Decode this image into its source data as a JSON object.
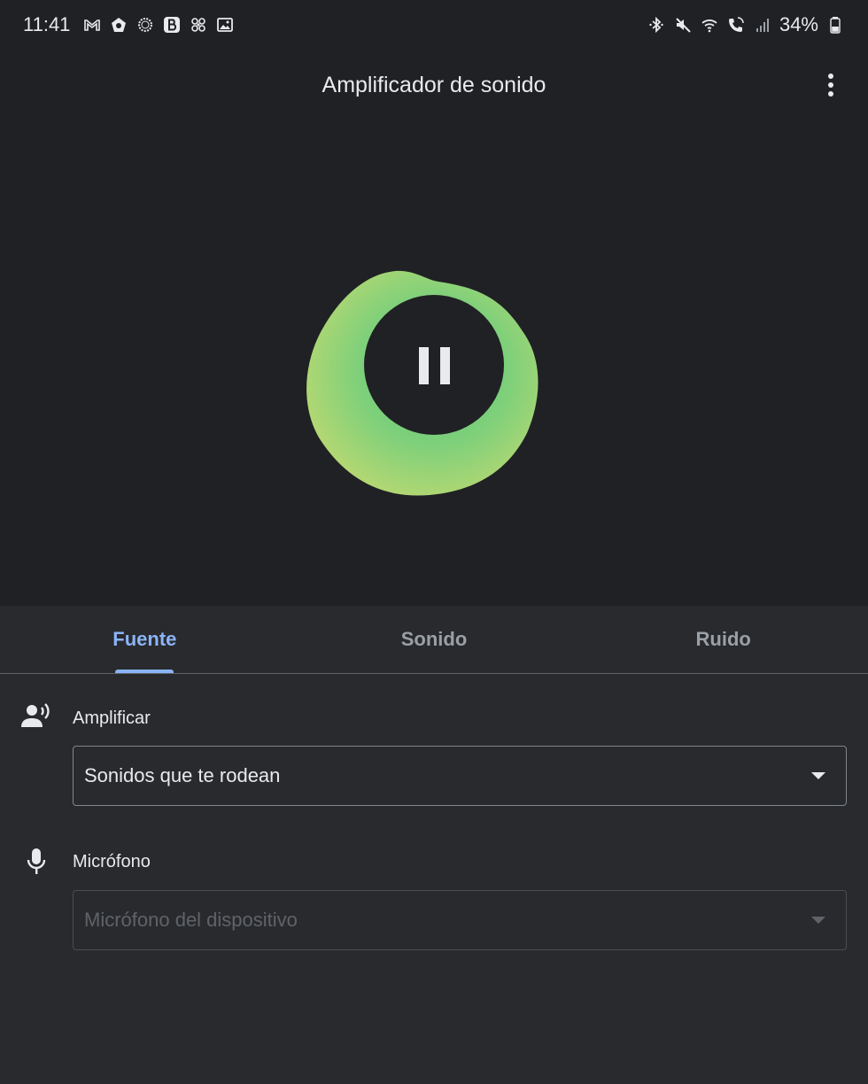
{
  "status_bar": {
    "time": "11:41",
    "battery": "34%",
    "left_icons": [
      "gmail-icon",
      "pentagon-app-icon",
      "sun-ring-icon",
      "b-app-icon",
      "fan-icon",
      "image-icon"
    ],
    "right_icons": [
      "bluetooth-icon",
      "mute-icon",
      "wifi-icon",
      "wifi-call-icon",
      "signal-icon",
      "battery-icon"
    ]
  },
  "app_bar": {
    "title": "Amplificador de sonido",
    "menu_icon": "more-vert-icon"
  },
  "hero": {
    "control_state": "playing",
    "control_icon": "pause-icon",
    "accent_colors": [
      "#6fcf7c",
      "#b5d86f"
    ]
  },
  "tabs": [
    {
      "label": "Fuente",
      "active": true
    },
    {
      "label": "Sonido",
      "active": false
    },
    {
      "label": "Ruido",
      "active": false
    }
  ],
  "source": {
    "amplify": {
      "icon": "record-voice-icon",
      "label": "Amplificar",
      "selected": "Sonidos que te rodean"
    },
    "microphone": {
      "icon": "mic-icon",
      "label": "Micrófono",
      "selected": "Micrófono del dispositivo",
      "enabled": false
    }
  },
  "colors": {
    "background": "#202124",
    "panel": "#292a2d",
    "accent": "#8ab4f8",
    "text": "#e8eaed",
    "muted": "#9aa0a6"
  }
}
